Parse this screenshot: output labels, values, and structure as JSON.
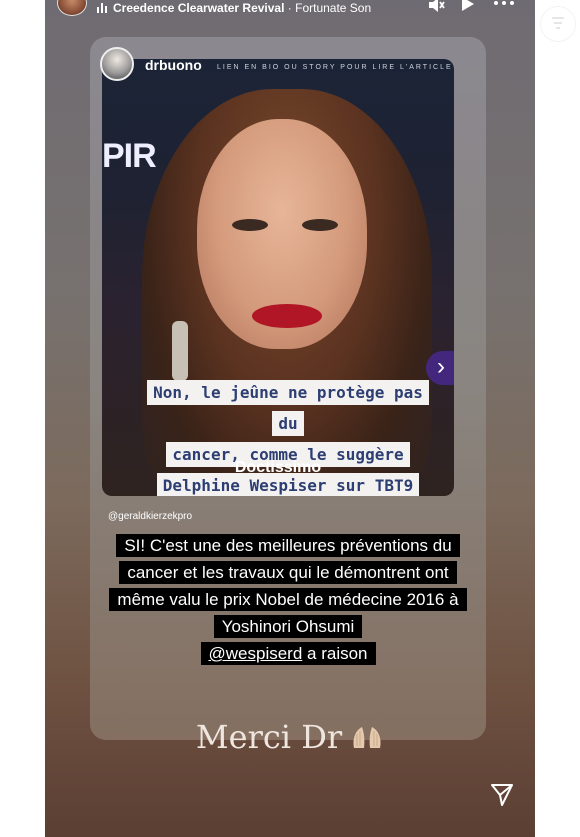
{
  "top_bar": {
    "artist": "Creedence Clearwater Revival",
    "separator": " · ",
    "song": "Fortunate Son"
  },
  "post": {
    "username": "drbuono",
    "photo_header_text": "LIEN EN BIO OU STORY POUR LIRE L'ARTICLE",
    "photo_sign_text": "PIR",
    "headline_lines": [
      "Non, le jeûne ne protège pas du",
      "cancer, comme le suggère",
      "Delphine Wespiser sur TBT9"
    ],
    "brand": "Doctissimo",
    "mention": "@geraldkierzekpro",
    "comment_lines": [
      "SI! C'est une des meilleures préventions du",
      "cancer et les travaux qui le démontrent ont",
      "même valu le prix Nobel de médecine 2016 à",
      "Yoshinori Ohsumi"
    ],
    "comment_handle": "@wespiserd",
    "comment_tail": " a raison"
  },
  "story_caption": "Merci Dr",
  "icons": [
    "music-icon",
    "mute-icon",
    "play-icon",
    "more-icon",
    "next-icon",
    "praying-hands-icon",
    "send-icon"
  ]
}
